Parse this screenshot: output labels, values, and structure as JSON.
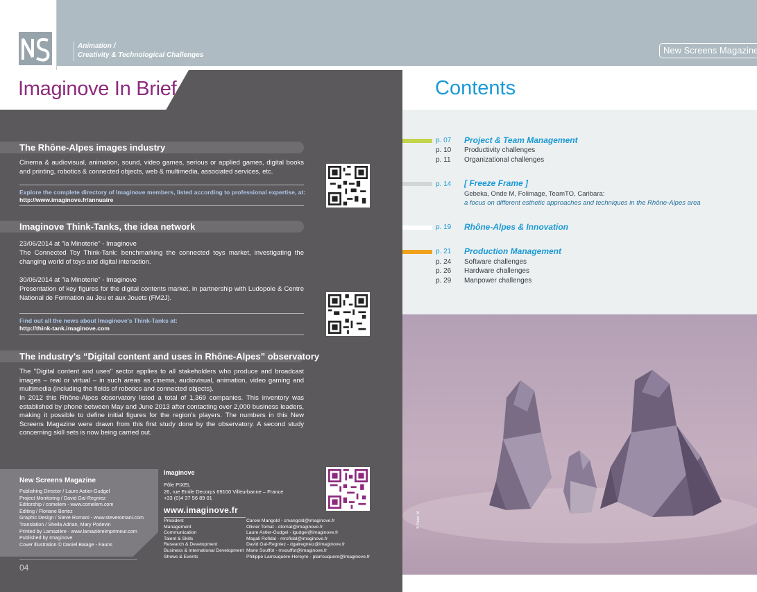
{
  "header": {
    "logo_text": "NS",
    "subtitle_line1": "Animation /",
    "subtitle_line2": "Creativity & Technological Challenges",
    "magazine_tag": "New Screens Magazine"
  },
  "left_page": {
    "title": "Imaginove In Brief",
    "sections": [
      {
        "title": "The Rhône-Alpes images industry",
        "body": "Cinema & audiovisual, animation, sound, video games, serious or applied games, digital books and printing, robotics & connected objects, web & multimedia, associated services, etc.",
        "link_note": "Explore the complete directory of Imaginove members, listed according to professional expertise, at:",
        "link_url": "http://www.imaginove.fr/annuaire"
      },
      {
        "title": "Imaginove Think-Tanks, the idea network",
        "events": [
          {
            "date_line": "23/06/2014 at \"la Minoterie\" - Imaginove",
            "text": "The Connected Toy Think-Tank: benchmarking the connected toys market, investigating the changing world of toys and digital interaction."
          },
          {
            "date_line": "30/06/2014 at \"la Minoterie\" - Imaginove",
            "text": "Presentation of key figures for the digital contents market, in partnership with Ludopole & Centre National de Formation au Jeu et aux Jouets (FM2J)."
          }
        ],
        "link_note": "Find out all the news about Imaginove's Think-Tanks at:",
        "link_url": "http://think-tank.imaginove.com"
      },
      {
        "title": "The industry's “Digital content and uses in Rhône-Alpes” observatory",
        "body1": "The \"Digital content and uses\" sector applies to all stakeholders who produce and broadcast images – real or virtual – in such areas as cinema, audiovisual, animation, video gaming and multimedia (including the fields of robotics and connected objects).",
        "body2": "In 2012 this Rhône-Alpes observatory listed a total of 1,369 companies. This inventory was established by phone between May and June 2013 after contacting over 2,000 business leaders, making it possible to define initial figures for the region's players. The numbers in this New Screens Magazine were drawn from this first study done by the observatory. A second study concerning skill sets is now being carried out."
      }
    ],
    "colophon": {
      "title": "New Screens Magazine",
      "lines": [
        "Publishing Director / Laure Astier-Gudgel",
        "Project Monitoring / David Gal-Regniez",
        "Editorship / comelem - www.comelem.com",
        "Editing / Floriane Bertez",
        "Graphic Design / Steve Romani - www.steveromani.com",
        "Translation / Sheila Adrian, Mary Podevin",
        "Printed by Lamazière - www.lamazièreimprimeur.com",
        "Published by Imaginove",
        "Cover illustration © Daniel Balage - Fauns"
      ]
    },
    "page_number": "04",
    "imaginove": {
      "name": "Imaginove",
      "address_line1": "Pôle PIXEL",
      "address_line2": "26, rue Emile Decorps 69100 Villeurbanne – France",
      "phone": "+33 (0)4 37 56 89 01",
      "website": "www.imaginove.fr"
    },
    "contacts": [
      {
        "role": "President",
        "person": "Carole Mangold - cmangold@imaginove.fr"
      },
      {
        "role": "Management",
        "person": "Olivier Tomat - otomat@imaginove.fr"
      },
      {
        "role": "Communication",
        "person": "Laure Astier-Gudgel - lgudgel@imaginove.fr"
      },
      {
        "role": "Talent & Skills",
        "person": "Magali Rofidal - mrofidal@imaginove.fr"
      },
      {
        "role": "Research & Development",
        "person": "David Gal-Regniez - dgalregniez@imaginove.fr"
      },
      {
        "role": "Business & International Development",
        "person": "Marie Souffot - msouffot@imaginove.fr"
      },
      {
        "role": "Shows & Events",
        "person": "Philippe Larrouquère-Hereyre - plarrouquere@imaginove.fr"
      }
    ]
  },
  "right_page": {
    "title": "Contents",
    "toc": [
      {
        "page": "p. 07",
        "title": "Project & Team Management",
        "bar_color": "#c2d44a",
        "subs": [
          {
            "page": "p. 10",
            "title": "Productivity challenges"
          },
          {
            "page": "p. 11",
            "title": "Organizational challenges"
          }
        ]
      },
      {
        "page": "p. 14",
        "title": "[ Freeze Frame ]",
        "bar_color": "#d3d6d8",
        "desc1": "Gebeka, Onde M, Folimage, TeamTO, Caribara:",
        "desc2": "a focus on different esthetic approaches and techniques in the Rhône-Alpes area"
      },
      {
        "page": "p. 19",
        "title": "Rhône-Alpes & Innovation",
        "bar_color": "#ffffff"
      },
      {
        "page": "p. 21",
        "title": "Production Management",
        "bar_color": "#f1a21c",
        "subs": [
          {
            "page": "p. 24",
            "title": "Software challenges"
          },
          {
            "page": "p. 26",
            "title": "Hardware challenges"
          },
          {
            "page": "p. 29",
            "title": "Manpower challenges"
          }
        ]
      }
    ],
    "photo_credit": "© Onde M"
  }
}
